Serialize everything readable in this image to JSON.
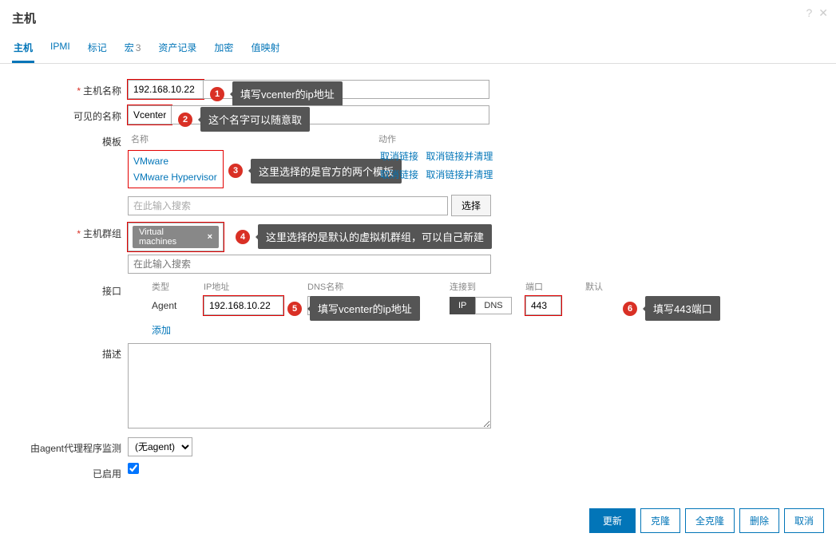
{
  "title": "主机",
  "tabs": [
    {
      "label": "主机",
      "active": true
    },
    {
      "label": "IPMI"
    },
    {
      "label": "标记"
    },
    {
      "label": "宏",
      "suffix": "3"
    },
    {
      "label": "资产记录"
    },
    {
      "label": "加密"
    },
    {
      "label": "值映射"
    }
  ],
  "labels": {
    "hostname": "主机名称",
    "visible_name": "可见的名称",
    "templates": "模板",
    "template_name_col": "名称",
    "template_action_col": "动作",
    "select": "选择",
    "search_placeholder": "在此输入搜索",
    "groups": "主机群组",
    "interfaces": "接口",
    "iface_type": "类型",
    "iface_ip": "IP地址",
    "iface_dns": "DNS名称",
    "iface_connect": "连接到",
    "iface_port": "端口",
    "iface_default": "默认",
    "add": "添加",
    "description": "描述",
    "monitored_by": "由agent代理程序监测",
    "enabled": "已启用"
  },
  "values": {
    "hostname": "192.168.10.22",
    "visible_name": "Vcenter",
    "templates": [
      "VMware",
      "VMware Hypervisor"
    ],
    "template_actions": {
      "unlink": "取消链接",
      "unlink_clear": "取消链接并清理"
    },
    "group_tag": "Virtual machines",
    "iface": {
      "type": "Agent",
      "ip": "192.168.10.22",
      "dns": "",
      "connect_ip": "IP",
      "connect_dns": "DNS",
      "port": "443"
    },
    "proxy": "(无agent)",
    "enabled": true
  },
  "annotations": {
    "a1": "填写vcenter的ip地址",
    "a2": "这个名字可以随意取",
    "a3": "这里选择的是官方的两个模板",
    "a4": "这里选择的是默认的虚拟机群组，可以自己新建",
    "a5": "填写vcenter的ip地址",
    "a6": "填写443端口"
  },
  "footer": {
    "update": "更新",
    "clone": "克隆",
    "full_clone": "全克隆",
    "delete": "删除",
    "cancel": "取消"
  }
}
